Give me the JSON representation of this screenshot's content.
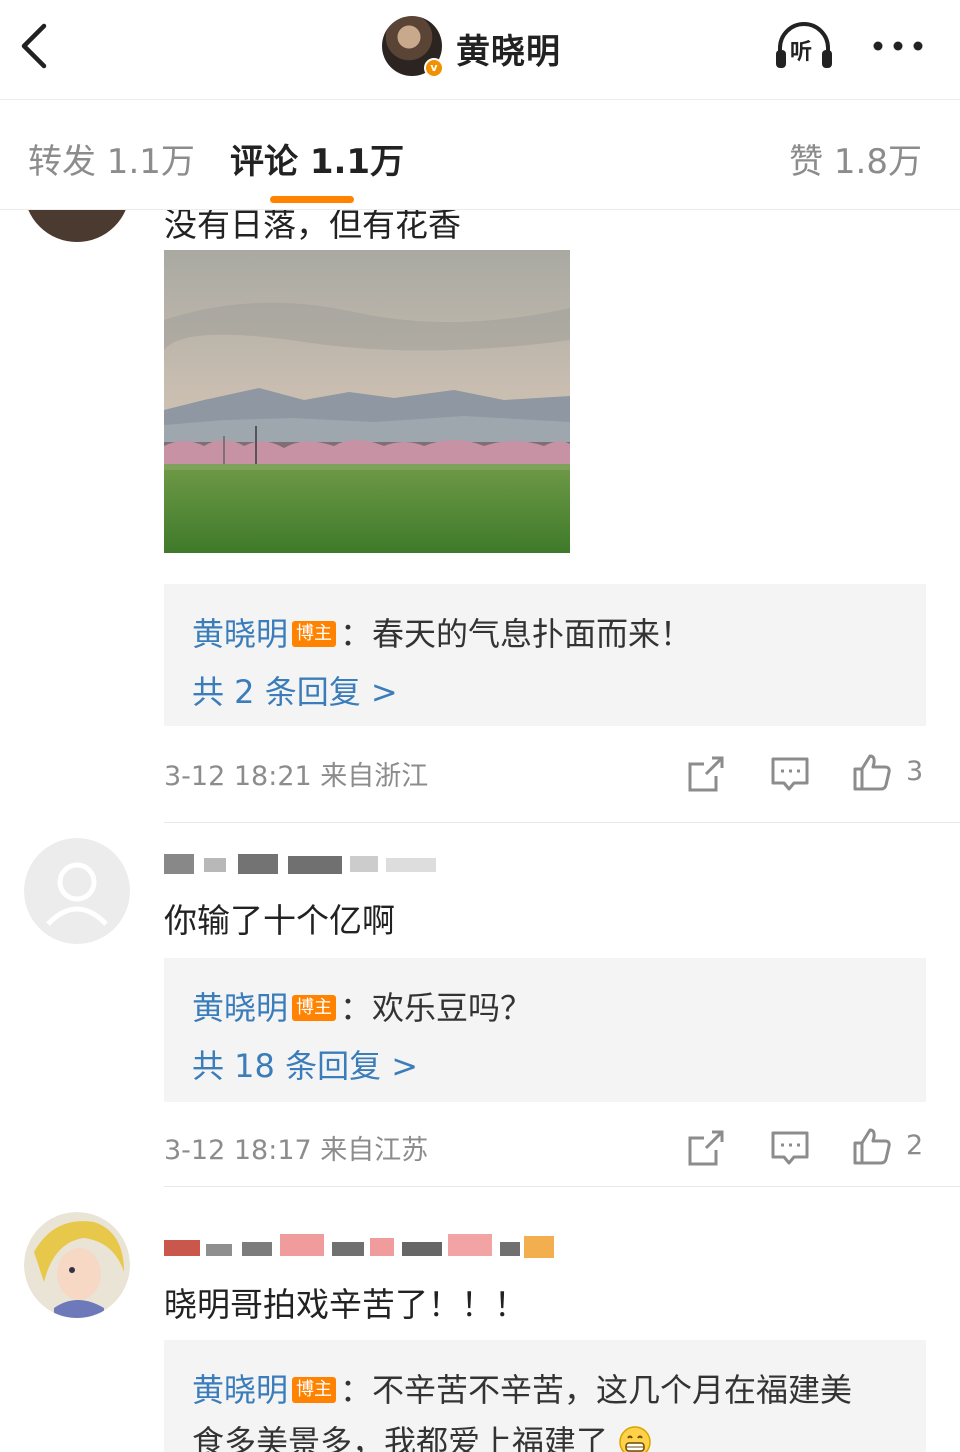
{
  "header": {
    "title": "黄晓明",
    "listen_label": "听"
  },
  "tabs": [
    {
      "label": "转发 1.1万"
    },
    {
      "label": "评论 1.1万"
    },
    {
      "label": "赞 1.8万"
    }
  ],
  "comments": [
    {
      "text": "没有日落，但有花香",
      "reply": {
        "author": "黄晓明",
        "badge": "博主",
        "text": "：春天的气息扑面而来！",
        "more": "共 2 条回复 >"
      },
      "meta": "3-12 18:21 来自浙江",
      "likes": "3"
    },
    {
      "text": "你输了十个亿啊",
      "reply": {
        "author": "黄晓明",
        "badge": "博主",
        "text": "：欢乐豆吗？",
        "more": "共 18 条回复 >"
      },
      "meta": "3-12 18:17 来自江苏",
      "likes": "2"
    },
    {
      "text": "晓明哥拍戏辛苦了！！！",
      "reply": {
        "author": "黄晓明",
        "badge": "博主",
        "text": "：不辛苦不辛苦，这几个月在福建美",
        "text2": "食多美景多，我都爱上福建了"
      }
    }
  ],
  "colors": {
    "accent": "#ff8200",
    "link": "#3b7dba",
    "meta": "#8c8c8c"
  }
}
